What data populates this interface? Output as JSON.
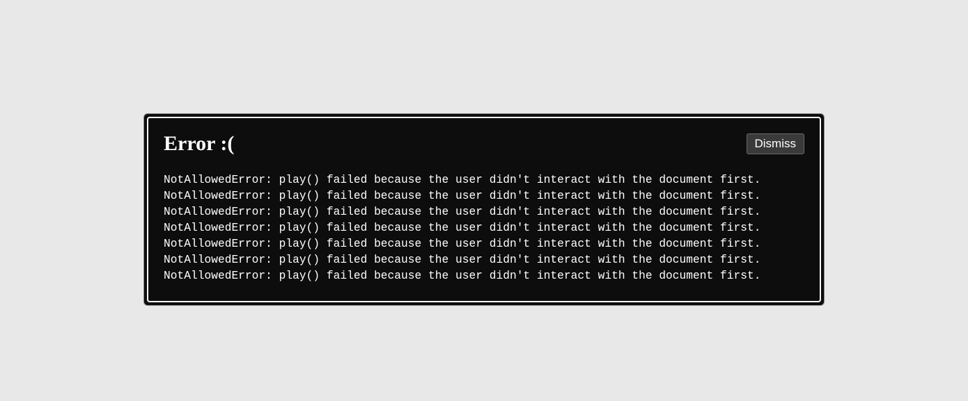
{
  "dialog": {
    "title": "Error :(",
    "dismiss_label": "Dismiss",
    "messages": [
      "NotAllowedError: play() failed because the user didn't interact with the document first.",
      "NotAllowedError: play() failed because the user didn't interact with the document first.",
      "NotAllowedError: play() failed because the user didn't interact with the document first.",
      "NotAllowedError: play() failed because the user didn't interact with the document first.",
      "NotAllowedError: play() failed because the user didn't interact with the document first.",
      "NotAllowedError: play() failed because the user didn't interact with the document first.",
      "NotAllowedError: play() failed because the user didn't interact with the document first."
    ]
  }
}
